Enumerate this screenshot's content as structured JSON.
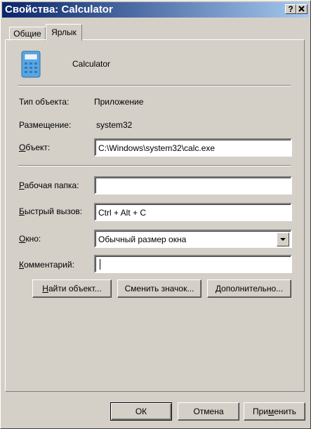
{
  "window": {
    "title": "Свойства: Calculator",
    "help_button": "?",
    "close_button": "X"
  },
  "tabs": [
    {
      "label": "Общие",
      "active": false
    },
    {
      "label": "Ярлык",
      "active": true
    }
  ],
  "header": {
    "name": "Calculator",
    "icon": "calculator-icon"
  },
  "info": {
    "type_label": "Тип объекта:",
    "type_value": "Приложение",
    "location_label": "Размещение:",
    "location_value": "system32"
  },
  "fields": {
    "target_label_u": "О",
    "target_label_rest": "бъект:",
    "target_value": "C:\\Windows\\system32\\calc.exe",
    "start_in_label_u": "Р",
    "start_in_label_rest": "абочая папка:",
    "start_in_value": "",
    "shortcut_label_u": "Б",
    "shortcut_label_rest": "ыстрый вызов:",
    "shortcut_value": "Ctrl + Alt + C",
    "run_label_u": "О",
    "run_label_rest": "кно:",
    "run_value": "Обычный размер окна",
    "comment_label_u": "К",
    "comment_label_rest": "омментарий:",
    "comment_value": ""
  },
  "actions": {
    "find_u": "Н",
    "find_rest": "айти объект...",
    "change_icon": "Сменить значок...",
    "advanced_u": "Д",
    "advanced_rest": "ополнительно..."
  },
  "dialog_buttons": {
    "ok": "ОК",
    "cancel": "Отмена",
    "apply_pre": "При",
    "apply_u": "м",
    "apply_post": "енить"
  }
}
